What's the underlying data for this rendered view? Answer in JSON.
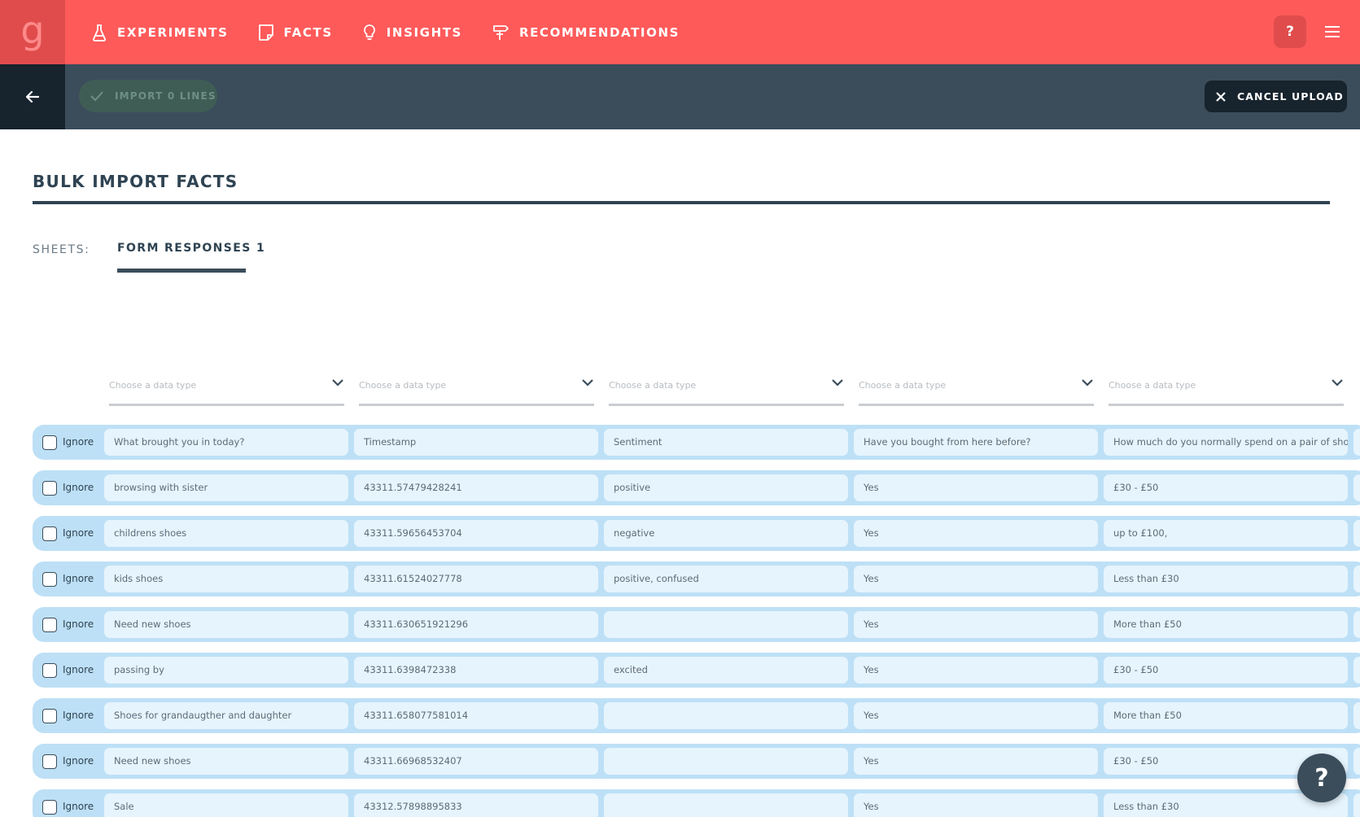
{
  "nav": {
    "logo_letter": "g",
    "items": [
      {
        "label": "EXPERIMENTS",
        "icon": "flask-icon"
      },
      {
        "label": "FACTS",
        "icon": "note-icon"
      },
      {
        "label": "INSIGHTS",
        "icon": "lightbulb-icon"
      },
      {
        "label": "RECOMMENDATIONS",
        "icon": "signpost-icon"
      }
    ],
    "help_label": "?"
  },
  "toolbar": {
    "import_label": "IMPORT 0 LINES",
    "cancel_label": "CANCEL UPLOAD"
  },
  "page": {
    "title": "BULK IMPORT FACTS",
    "sheets_label": "SHEETS:",
    "active_sheet": "FORM RESPONSES 1"
  },
  "column_select_placeholder": "Choose a data type",
  "ignore_label": "Ignore",
  "rows": [
    [
      "What brought you in today?",
      "Timestamp",
      "Sentiment",
      "Have you bought from here before?",
      "How much do you normally spend on a pair of shoes?"
    ],
    [
      "browsing with sister",
      "43311.57479428241",
      "positive",
      "Yes",
      "£30 - £50"
    ],
    [
      "childrens shoes",
      "43311.59656453704",
      "negative",
      "Yes",
      "up to £100,"
    ],
    [
      "kids shoes",
      "43311.61524027778",
      "positive, confused",
      "Yes",
      "Less than £30"
    ],
    [
      "Need new shoes",
      "43311.630651921296",
      "",
      "Yes",
      "More than £50"
    ],
    [
      "passing by",
      "43311.6398472338",
      "excited",
      "Yes",
      "£30 - £50"
    ],
    [
      "Shoes for grandaugther and daughter",
      "43311.658077581014",
      "",
      "Yes",
      "More than £50"
    ],
    [
      "Need new shoes",
      "43311.66968532407",
      "",
      "Yes",
      "£30 - £50"
    ],
    [
      "Sale",
      "43312.57898895833",
      "",
      "Yes",
      "Less than £30"
    ]
  ],
  "fab_label": "?",
  "colors": {
    "brand": "#ff5a5a",
    "toolbar": "#3b4d5b",
    "row_bg": "#bde0f6",
    "cell_bg": "#e6f4fd"
  }
}
